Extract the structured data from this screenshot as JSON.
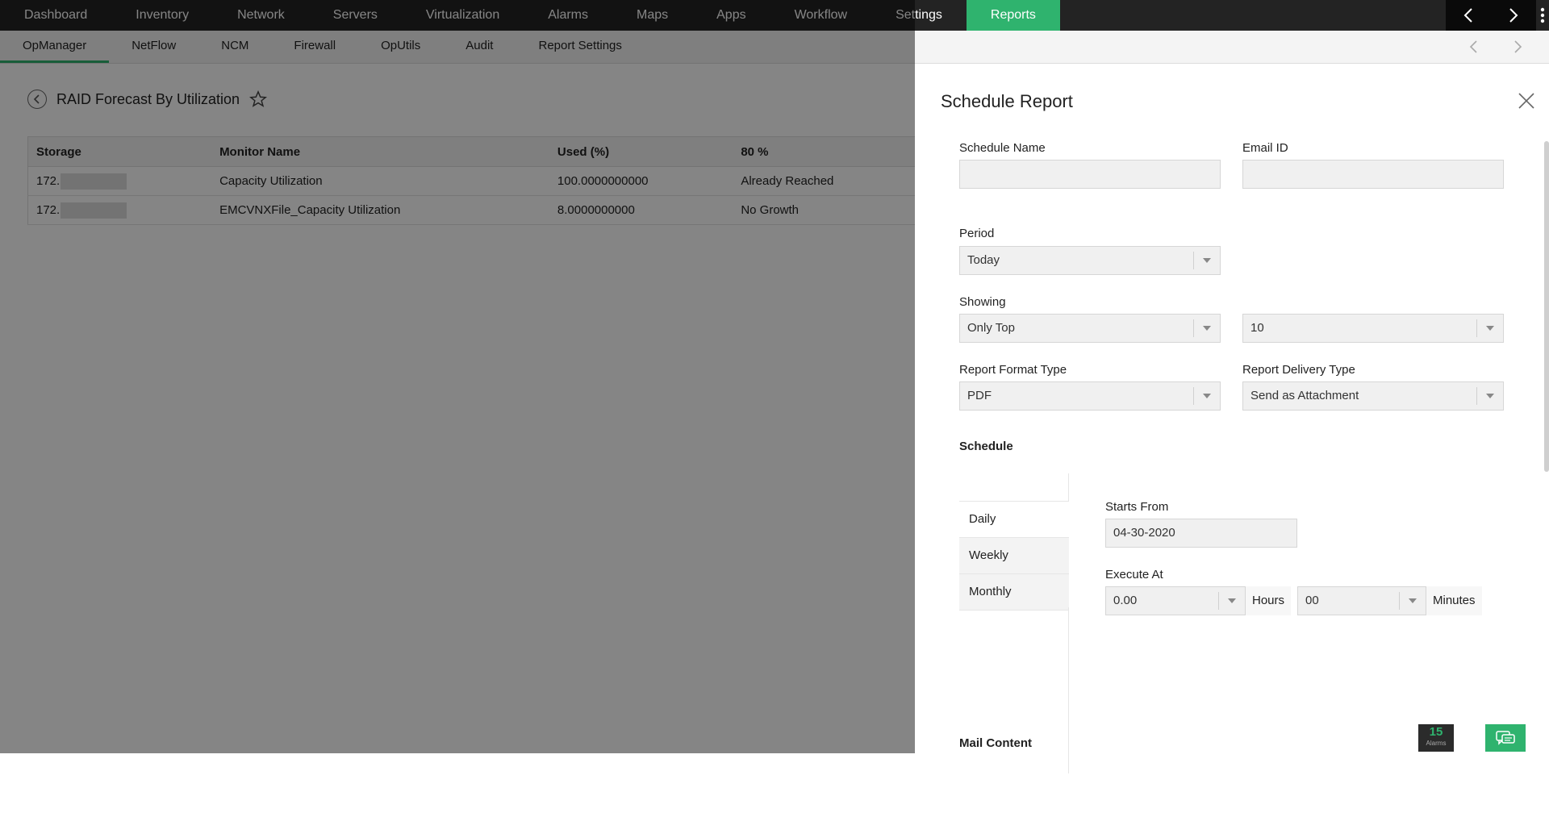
{
  "topnav": {
    "items": [
      "Dashboard",
      "Inventory",
      "Network",
      "Servers",
      "Virtualization",
      "Alarms",
      "Maps",
      "Apps",
      "Workflow",
      "Settings",
      "Reports"
    ],
    "active": "Reports"
  },
  "subnav": {
    "items": [
      "OpManager",
      "NetFlow",
      "NCM",
      "Firewall",
      "OpUtils",
      "Audit",
      "Report Settings"
    ],
    "active": "OpManager"
  },
  "page": {
    "title": "RAID Forecast By Utilization",
    "table": {
      "headers": [
        "Storage",
        "Monitor Name",
        "Used (%)",
        "80 %"
      ],
      "rows": [
        [
          "172.",
          "Capacity Utilization",
          "100.0000000000",
          "Already Reached"
        ],
        [
          "172.",
          "EMCVNXFile_Capacity Utilization",
          "8.0000000000",
          "No Growth"
        ]
      ]
    }
  },
  "panel": {
    "title": "Schedule Report",
    "schedule_name_label": "Schedule Name",
    "schedule_name_value": "",
    "email_label": "Email ID",
    "email_value": "",
    "period_label": "Period",
    "period_value": "Today",
    "showing_label": "Showing",
    "showing_value": "Only Top",
    "showing_count": "10",
    "format_label": "Report Format Type",
    "format_value": "PDF",
    "delivery_label": "Report Delivery Type",
    "delivery_value": "Send as Attachment",
    "schedule_section": "Schedule",
    "tabs": [
      "Daily",
      "Weekly",
      "Monthly"
    ],
    "active_tab": "Daily",
    "starts_from_label": "Starts From",
    "starts_from_value": "04-30-2020",
    "execute_at_label": "Execute At",
    "hours_value": "0.00",
    "hours_label": "Hours",
    "minutes_value": "00",
    "minutes_label": "Minutes",
    "mail_content_label": "Mail Content"
  },
  "alarms_badge": {
    "count": "15",
    "label": "Alarms"
  },
  "colors": {
    "accent": "#2fb36e",
    "topnav_bg": "#232323"
  }
}
